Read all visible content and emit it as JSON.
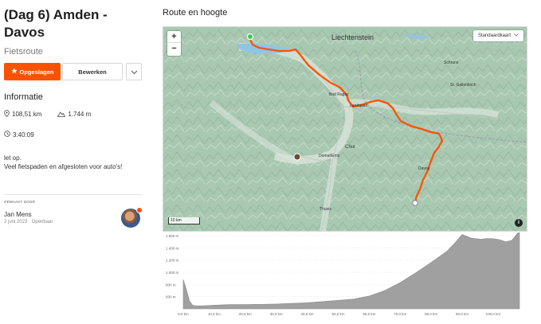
{
  "route": {
    "title_line1": "(Dag 6) Amden -",
    "title_line2": "Davos",
    "type": "Fietsroute",
    "saved_label": "Opgeslagen",
    "edit_label": "Bewerken"
  },
  "info": {
    "heading": "Informatie",
    "distance": "108,51 km",
    "elevation": "1.744 m",
    "time": "3:40:09",
    "description_line1": "let op.",
    "description_line2": "Veel fietspaden en afgesloten voor auto's!"
  },
  "creator": {
    "made_by_label": "GEMAAKT DOOR",
    "name": "Jan Mens",
    "meta": "2 juni 2023 · Openbaar"
  },
  "map": {
    "heading": "Route en hoogte",
    "zoom_in": "+",
    "zoom_out": "−",
    "map_type": "Standaardkaart",
    "scale": "10 km",
    "info_icon": "i",
    "labels": {
      "liechtenstein": "Liechtenstein",
      "schruns": "Schruns",
      "bad_ragaz": "Bad Ragaz",
      "landquart": "Landquart",
      "st_gallenkirch": "St. Gallenkirch",
      "chur": "Chur",
      "domat_ems": "Domat/Ems",
      "davos": "Davos",
      "thusis": "Thusis"
    },
    "route_color": "#fc5200",
    "start_color": "#3ec95a"
  },
  "chart_data": {
    "type": "area",
    "title": "",
    "xlabel": "",
    "ylabel": "",
    "ylim": [
      0,
      1600
    ],
    "yticks": [
      "600 m",
      "800 m",
      "1.000 m",
      "1.200 m",
      "1.400 m",
      "1.600 m"
    ],
    "ytick_values": [
      600,
      800,
      1000,
      1200,
      1400,
      1600
    ],
    "xticks": [
      "0,0 km",
      "10,0 km",
      "20,0 km",
      "30,0 km",
      "40,0 km",
      "50,0 km",
      "60,0 km",
      "70,0 km",
      "80,0 km",
      "90,0 km",
      "100,0 km"
    ],
    "xtick_values": [
      0,
      10,
      20,
      30,
      40,
      50,
      60,
      70,
      80,
      90,
      100
    ],
    "xlim": [
      0,
      108.51
    ],
    "ymin": 400,
    "x": [
      0,
      1,
      2,
      3,
      4,
      6,
      8,
      10,
      15,
      20,
      25,
      30,
      35,
      40,
      45,
      50,
      55,
      60,
      65,
      70,
      75,
      80,
      85,
      88,
      90,
      93,
      96,
      98,
      100,
      102,
      104,
      106,
      108.51
    ],
    "values": [
      880,
      720,
      530,
      460,
      450,
      450,
      455,
      460,
      470,
      470,
      475,
      480,
      490,
      500,
      520,
      540,
      560,
      610,
      700,
      830,
      990,
      1160,
      1340,
      1500,
      1620,
      1560,
      1540,
      1555,
      1550,
      1535,
      1500,
      1520,
      1680
    ],
    "fill": "#a0a0a0"
  }
}
